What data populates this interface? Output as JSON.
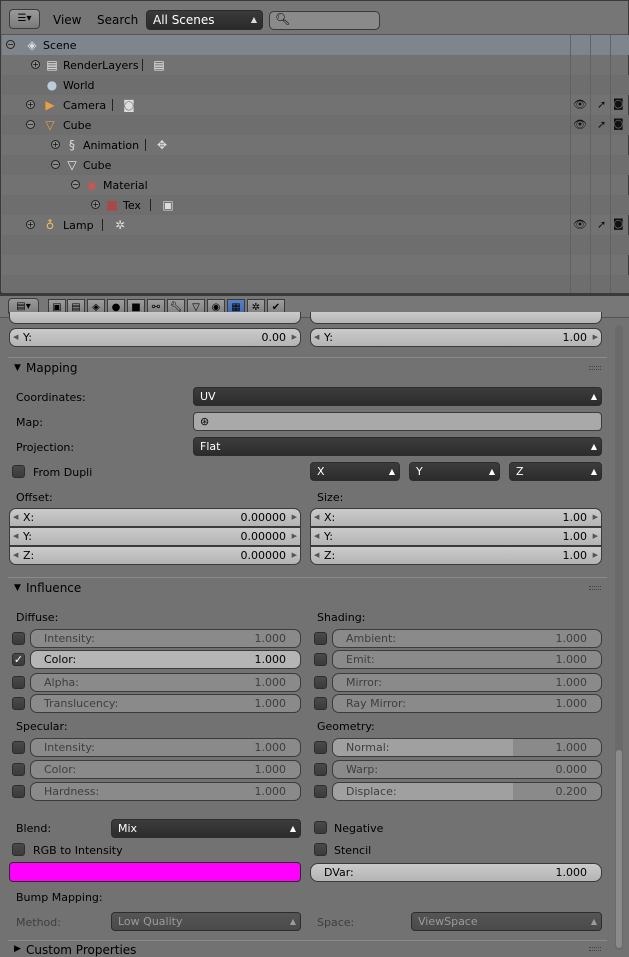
{
  "outliner": {
    "editor_type_icon": "outliner-icon",
    "menu": {
      "view": "View",
      "search": "Search"
    },
    "scene_filter": {
      "value": "All Scenes"
    },
    "search": {
      "placeholder": ""
    },
    "tree": [
      {
        "label": "Scene",
        "icon": "scene-icon",
        "expanded": true
      },
      {
        "label": "RenderLayers",
        "icon": "renderlayers-icon",
        "expanded": false
      },
      {
        "label": "World",
        "icon": "world-icon"
      },
      {
        "label": "Camera",
        "icon": "camera-icon",
        "expanded": false
      },
      {
        "label": "Cube",
        "icon": "mesh-object-icon",
        "expanded": true
      },
      {
        "label": "Animation",
        "icon": "animation-icon",
        "expanded": false
      },
      {
        "label": "Cube",
        "icon": "mesh-data-icon",
        "expanded": true
      },
      {
        "label": "Material",
        "icon": "material-icon",
        "expanded": true
      },
      {
        "label": "Tex",
        "icon": "texture-icon",
        "expanded": false
      },
      {
        "label": "Lamp",
        "icon": "lamp-icon",
        "expanded": false
      }
    ],
    "restrict_icons": [
      "eye-icon",
      "cursor-icon",
      "render-icon"
    ]
  },
  "properties": {
    "contexts": [
      "render",
      "render-layers",
      "scene",
      "world",
      "object",
      "constraints",
      "modifiers",
      "data",
      "material",
      "texture",
      "particles",
      "physics"
    ],
    "active_context": "texture",
    "top_partial": {
      "left": {
        "label": "Y:",
        "value": "0.00"
      },
      "right": {
        "label": "Y:",
        "value": "1.00"
      }
    },
    "mapping": {
      "title": "Mapping",
      "coordinates_label": "Coordinates:",
      "coordinates_value": "UV",
      "map_label": "Map:",
      "projection_label": "Projection:",
      "projection_value": "Flat",
      "from_dupli": "From Dupli",
      "axes": [
        "X",
        "Y",
        "Z"
      ],
      "offset_label": "Offset:",
      "size_label": "Size:",
      "offset": [
        {
          "label": "X:",
          "value": "0.00000"
        },
        {
          "label": "Y:",
          "value": "0.00000"
        },
        {
          "label": "Z:",
          "value": "0.00000"
        }
      ],
      "size": [
        {
          "label": "X:",
          "value": "1.00"
        },
        {
          "label": "Y:",
          "value": "1.00"
        },
        {
          "label": "Z:",
          "value": "1.00"
        }
      ]
    },
    "influence": {
      "title": "Influence",
      "diffuse_label": "Diffuse:",
      "shading_label": "Shading:",
      "specular_label": "Specular:",
      "geometry_label": "Geometry:",
      "diffuse": [
        {
          "label": "Intensity:",
          "value": "1.000",
          "checked": false
        },
        {
          "label": "Color:",
          "value": "1.000",
          "checked": true
        },
        {
          "label": "Alpha:",
          "value": "1.000",
          "checked": false
        },
        {
          "label": "Translucency:",
          "value": "1.000",
          "checked": false
        }
      ],
      "shading": [
        {
          "label": "Ambient:",
          "value": "1.000",
          "checked": false
        },
        {
          "label": "Emit:",
          "value": "1.000",
          "checked": false
        },
        {
          "label": "Mirror:",
          "value": "1.000",
          "checked": false
        },
        {
          "label": "Ray Mirror:",
          "value": "1.000",
          "checked": false
        }
      ],
      "specular": [
        {
          "label": "Intensity:",
          "value": "1.000",
          "checked": false
        },
        {
          "label": "Color:",
          "value": "1.000",
          "checked": false
        },
        {
          "label": "Hardness:",
          "value": "1.000",
          "checked": false
        }
      ],
      "geometry": [
        {
          "label": "Normal:",
          "value": "1.000",
          "checked": false,
          "level": 0.67
        },
        {
          "label": "Warp:",
          "value": "0.000",
          "checked": false,
          "level": 0.0
        },
        {
          "label": "Displace:",
          "value": "0.200",
          "checked": false,
          "level": 0.67
        }
      ],
      "blend_label": "Blend:",
      "blend_value": "Mix",
      "negative": "Negative",
      "rgb_to_intensity": "RGB to Intensity",
      "stencil": "Stencil",
      "color": "#ff00ff",
      "dvar_label": "DVar:",
      "dvar_value": "1.000",
      "bump_mapping_label": "Bump Mapping:",
      "method_label": "Method:",
      "method_value": "Low Quality",
      "space_label": "Space:",
      "space_value": "ViewSpace"
    },
    "custom_properties": {
      "title": "Custom Properties"
    }
  }
}
